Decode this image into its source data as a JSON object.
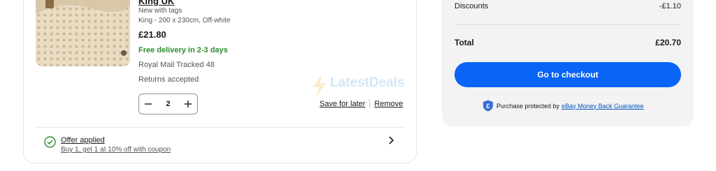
{
  "item": {
    "title": "King UK",
    "condition": "New with tags",
    "variant": "King - 200 x 230cm, Off-white",
    "price": "£21.80",
    "delivery": "Free delivery in 2-3 days",
    "shipping": "Royal Mail Tracked 48",
    "returns": "Returns accepted",
    "quantity": "2",
    "save_for_later": "Save for later",
    "remove": "Remove"
  },
  "offer": {
    "title": "Offer applied",
    "subtitle": "Buy 1, get 1 at 10% off with coupon"
  },
  "watermark": {
    "text": "LatestDeals"
  },
  "summary": {
    "discounts_label": "Discounts",
    "discounts_value": "-£1.10",
    "total_label": "Total",
    "total_value": "£20.70",
    "checkout_label": "Go to checkout",
    "protection_text": "Purchase protected by",
    "protection_link": "eBay Money Back Guarantee"
  },
  "colors": {
    "accent": "#0a64f5",
    "delivery_green": "#2e8b2e",
    "link_blue": "#0654ba"
  },
  "icons": [
    "minus-icon",
    "plus-icon",
    "check-circle-icon",
    "chevron-right-icon",
    "shield-pound-icon",
    "lightning-icon"
  ]
}
